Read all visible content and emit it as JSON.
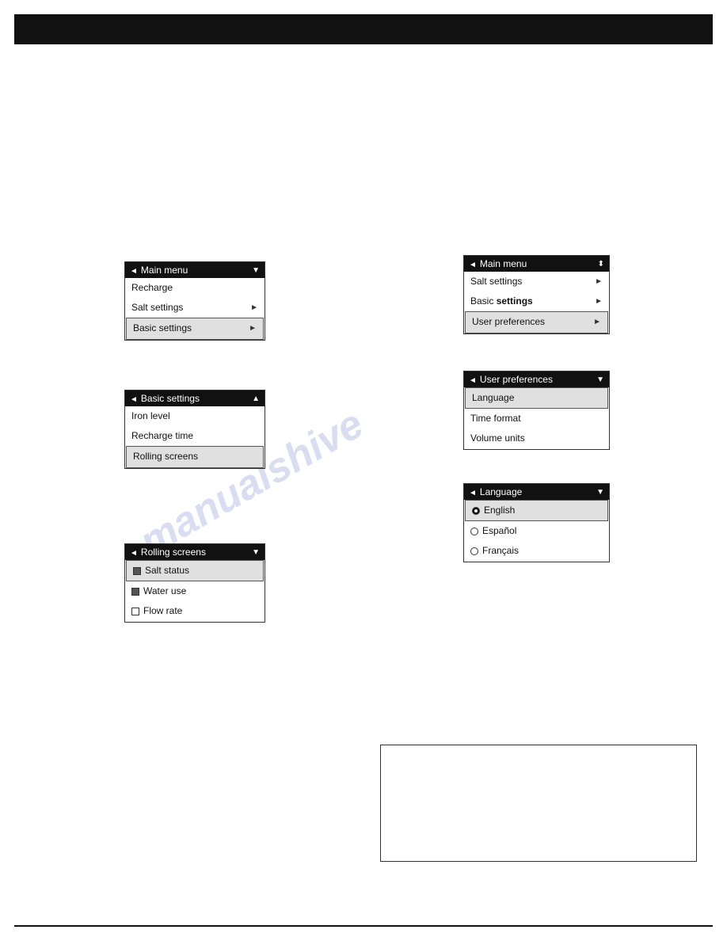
{
  "topBar": {
    "label": ""
  },
  "watermark": {
    "text": "manualshive"
  },
  "menus": {
    "mainMenu1": {
      "title": "Main menu",
      "items": [
        {
          "label": "Recharge",
          "hasArrow": false,
          "highlighted": false
        },
        {
          "label": "Salt settings",
          "hasArrow": true,
          "highlighted": false
        },
        {
          "label": "Basic settings",
          "hasArrow": true,
          "highlighted": true
        }
      ]
    },
    "mainMenu2": {
      "title": "Main menu",
      "items": [
        {
          "label": "Salt settings",
          "hasArrow": true,
          "highlighted": false
        },
        {
          "label": "Basic settings",
          "hasArrow": true,
          "highlighted": false
        },
        {
          "label": "User preferences",
          "hasArrow": true,
          "highlighted": true
        }
      ]
    },
    "basicSettings": {
      "title": "Basic settings",
      "items": [
        {
          "label": "Iron level",
          "hasArrow": false,
          "highlighted": false
        },
        {
          "label": "Recharge time",
          "hasArrow": false,
          "highlighted": false
        },
        {
          "label": "Rolling screens",
          "hasArrow": false,
          "highlighted": true
        }
      ]
    },
    "userPreferences": {
      "title": "User preferences",
      "items": [
        {
          "label": "Language",
          "hasArrow": false,
          "highlighted": true
        },
        {
          "label": "Time format",
          "hasArrow": false,
          "highlighted": false
        },
        {
          "label": "Volume units",
          "hasArrow": false,
          "highlighted": false
        }
      ]
    },
    "rollingScreens": {
      "title": "Rolling screens",
      "items": [
        {
          "label": "Salt status",
          "hasArrow": false,
          "highlighted": true,
          "checkbox": "filled"
        },
        {
          "label": "Water use",
          "hasArrow": false,
          "highlighted": false,
          "checkbox": "filled"
        },
        {
          "label": "Flow rate",
          "hasArrow": false,
          "highlighted": false,
          "checkbox": "empty"
        }
      ]
    },
    "language": {
      "title": "Language",
      "items": [
        {
          "label": "English",
          "highlighted": true,
          "radio": "filled"
        },
        {
          "label": "Español",
          "highlighted": false,
          "radio": "empty"
        },
        {
          "label": "Français",
          "highlighted": false,
          "radio": "empty"
        }
      ]
    }
  },
  "largeBox": {
    "visible": true
  }
}
